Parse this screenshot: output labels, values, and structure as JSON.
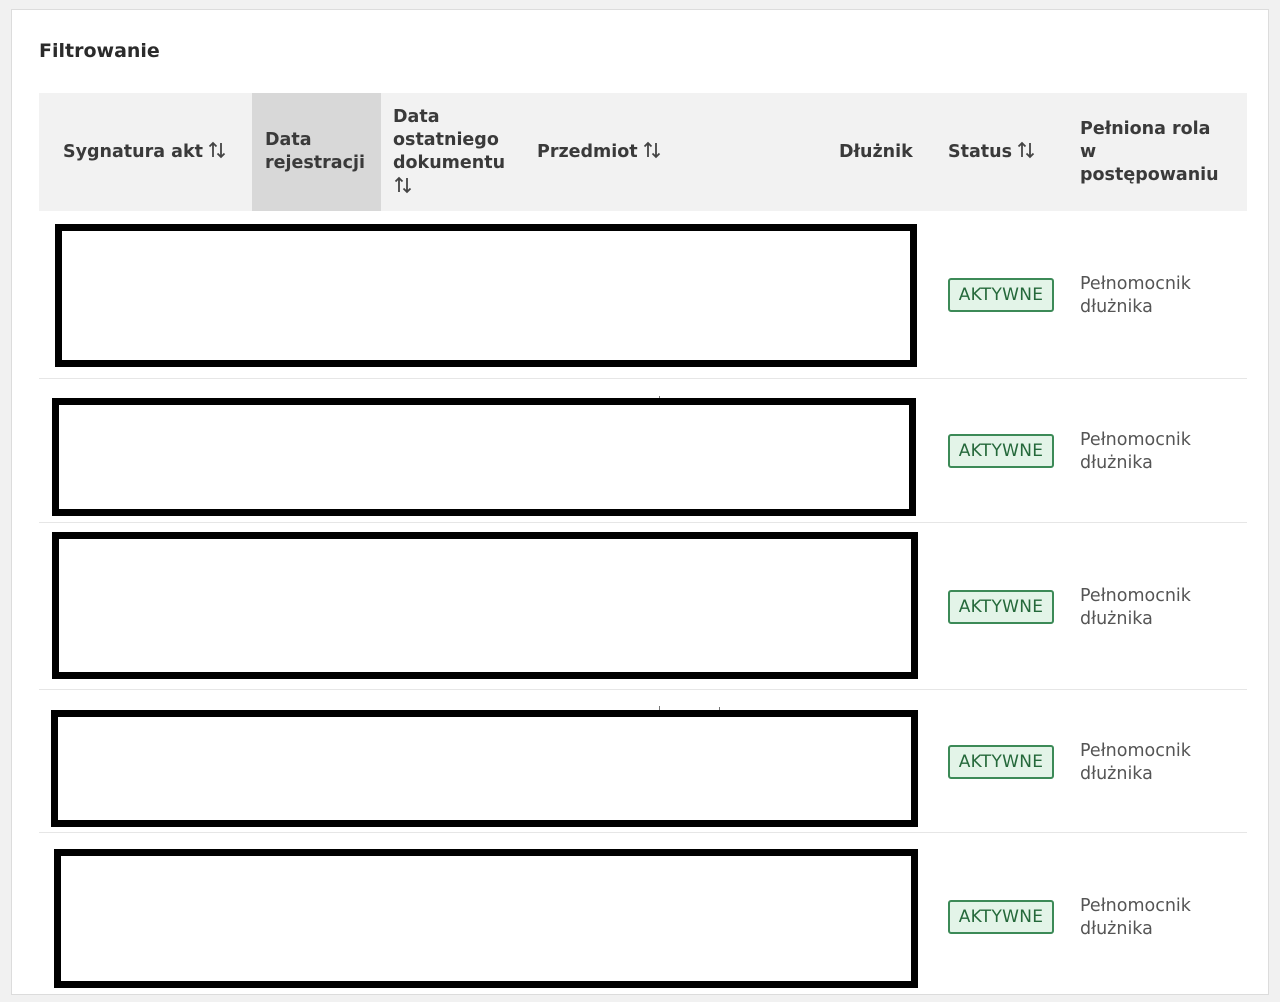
{
  "panel": {
    "title": "Filtrowanie"
  },
  "columns": [
    {
      "id": "sygnatura",
      "lines": [
        "Sygnatura akt"
      ],
      "sortable": true,
      "active": false
    },
    {
      "id": "data-rejestracji",
      "lines": [
        "Data",
        "rejestracji"
      ],
      "sortable": false,
      "active": true
    },
    {
      "id": "data-ostatniego-dokumentu",
      "lines": [
        "Data",
        "ostatniego",
        "dokumentu"
      ],
      "sortable": true,
      "active": false
    },
    {
      "id": "przedmiot",
      "lines": [
        "Przedmiot"
      ],
      "sortable": true,
      "active": false
    },
    {
      "id": "dluznik",
      "lines": [
        "Dłużnik"
      ],
      "sortable": false,
      "active": false
    },
    {
      "id": "status",
      "lines": [
        "Status"
      ],
      "sortable": true,
      "active": false
    },
    {
      "id": "pelniona-rola",
      "lines": [
        "Pełniona rola",
        "w",
        "postępowaniu"
      ],
      "sortable": false,
      "active": false
    }
  ],
  "rows": [
    {
      "status": "AKTYWNE",
      "role_line1": "Pełnomocnik",
      "role_line2": "dłużnika"
    },
    {
      "status": "AKTYWNE",
      "role_line1": "Pełnomocnik",
      "role_line2": "dłużnika"
    },
    {
      "status": "AKTYWNE",
      "role_line1": "Pełnomocnik",
      "role_line2": "dłużnika"
    },
    {
      "status": "AKTYWNE",
      "role_line1": "Pełnomocnik",
      "role_line2": "dłużnika"
    },
    {
      "status": "AKTYWNE",
      "role_line1": "Pełnomocnik",
      "role_line2": "dłużnika"
    }
  ],
  "icons": {
    "sort": "sort-arrows-icon"
  },
  "colors": {
    "status_bg": "#e3f4e8",
    "status_border": "#3c8a57",
    "status_text": "#24683a",
    "header_bg": "#f2f2f2",
    "active_header_bg": "#d8d8d8"
  }
}
